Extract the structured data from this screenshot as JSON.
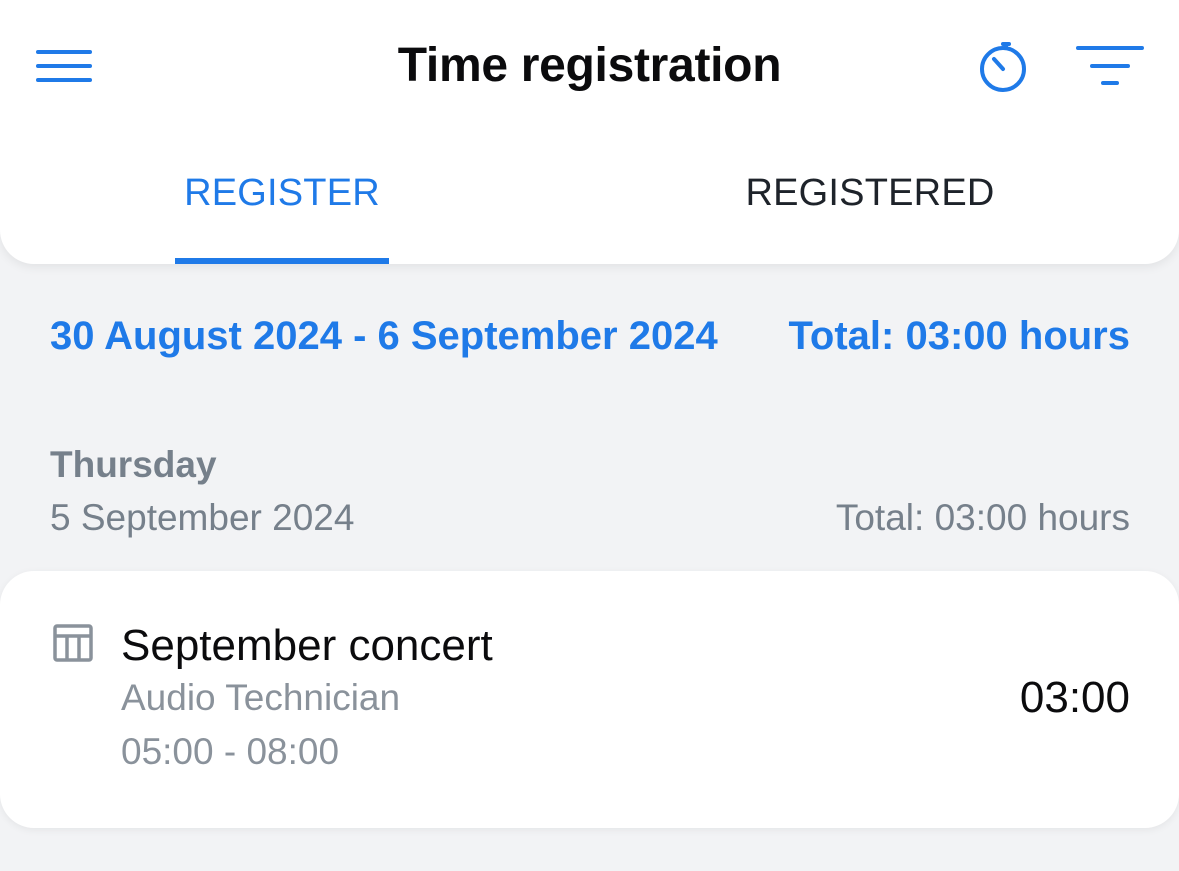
{
  "header": {
    "title": "Time registration",
    "icons": {
      "menu": "hamburger-menu-icon",
      "timer": "stopwatch-icon",
      "filter": "filter-icon"
    }
  },
  "tabs": [
    {
      "label": "REGISTER",
      "active": true
    },
    {
      "label": "REGISTERED",
      "active": false
    }
  ],
  "period": {
    "range": "30 August 2024 - 6 September 2024",
    "total": "Total: 03:00 hours"
  },
  "days": [
    {
      "weekday": "Thursday",
      "date": "5 September 2024",
      "total": "Total: 03:00 hours",
      "entries": [
        {
          "icon": "venue-table-icon",
          "title": "September concert",
          "role": "Audio Technician",
          "time": "05:00 - 08:00",
          "duration": "03:00"
        }
      ]
    }
  ],
  "colors": {
    "accent": "#1f7ae8",
    "background": "#f2f3f5",
    "muted_text": "#76808b",
    "primary_text": "#0b0b0d"
  }
}
